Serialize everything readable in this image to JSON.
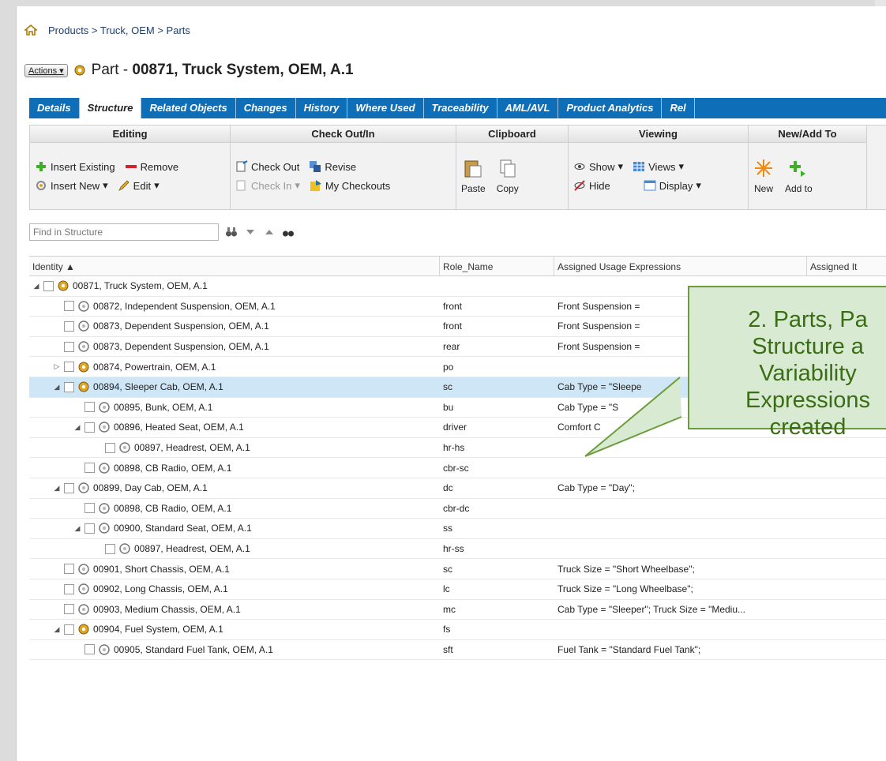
{
  "breadcrumb": "Products > Truck, OEM > Parts",
  "header": {
    "actions_label": "Actions",
    "title_prefix": "Part - ",
    "title_bold": "00871, Truck System, OEM, A.1"
  },
  "tabs": [
    "Details",
    "Structure",
    "Related Objects",
    "Changes",
    "History",
    "Where Used",
    "Traceability",
    "AML/AVL",
    "Product Analytics",
    "Rel"
  ],
  "ribbon": {
    "editing": {
      "title": "Editing",
      "insert_existing": "Insert Existing",
      "remove": "Remove",
      "insert_new": "Insert New",
      "edit": "Edit"
    },
    "checkout": {
      "title": "Check Out/In",
      "check_out": "Check Out",
      "revise": "Revise",
      "check_in": "Check In",
      "my_checkouts": "My Checkouts"
    },
    "clipboard": {
      "title": "Clipboard",
      "paste": "Paste",
      "copy": "Copy"
    },
    "viewing": {
      "title": "Viewing",
      "show": "Show",
      "views": "Views",
      "hide": "Hide",
      "display": "Display"
    },
    "newadd": {
      "title": "New/Add To",
      "new": "New",
      "add_to": "Add to"
    }
  },
  "find": {
    "placeholder": "Find in Structure"
  },
  "columns": [
    "Identity ▲",
    "Role_Name",
    "Assigned Usage Expressions",
    "Assigned It"
  ],
  "rows": [
    {
      "identity": "00871, Truck System, OEM, A.1",
      "role": "",
      "expr": ""
    },
    {
      "identity": "00872, Independent Suspension, OEM, A.1",
      "role": "front",
      "expr": "Front Suspension ="
    },
    {
      "identity": "00873, Dependent Suspension, OEM, A.1",
      "role": "front",
      "expr": "Front Suspension ="
    },
    {
      "identity": "00873, Dependent Suspension, OEM, A.1",
      "role": "rear",
      "expr": "Front Suspension ="
    },
    {
      "identity": "00874, Powertrain, OEM, A.1",
      "role": "po",
      "expr": ""
    },
    {
      "identity": "00894, Sleeper Cab, OEM, A.1",
      "role": "sc",
      "expr": "Cab Type = \"Sleepe"
    },
    {
      "identity": "00895, Bunk, OEM, A.1",
      "role": "bu",
      "expr": "Cab Type = \"S"
    },
    {
      "identity": "00896, Heated Seat, OEM, A.1",
      "role": "driver",
      "expr": "Comfort C"
    },
    {
      "identity": "00897, Headrest, OEM, A.1",
      "role": "hr-hs",
      "expr": ""
    },
    {
      "identity": "00898, CB Radio, OEM, A.1",
      "role": "cbr-sc",
      "expr": ""
    },
    {
      "identity": "00899, Day Cab, OEM, A.1",
      "role": "dc",
      "expr": "Cab Type = \"Day\";"
    },
    {
      "identity": "00898, CB Radio, OEM, A.1",
      "role": "cbr-dc",
      "expr": ""
    },
    {
      "identity": "00900, Standard Seat, OEM, A.1",
      "role": "ss",
      "expr": ""
    },
    {
      "identity": "00897, Headrest, OEM, A.1",
      "role": "hr-ss",
      "expr": ""
    },
    {
      "identity": "00901, Short Chassis, OEM, A.1",
      "role": "sc",
      "expr": "Truck Size = \"Short Wheelbase\";"
    },
    {
      "identity": "00902, Long Chassis, OEM, A.1",
      "role": "lc",
      "expr": "Truck Size = \"Long Wheelbase\";"
    },
    {
      "identity": "00903, Medium Chassis, OEM, A.1",
      "role": "mc",
      "expr": "Cab Type = \"Sleeper\"; Truck Size = \"Mediu..."
    },
    {
      "identity": "00904, Fuel System, OEM, A.1",
      "role": "fs",
      "expr": ""
    },
    {
      "identity": "00905, Standard Fuel Tank, OEM, A.1",
      "role": "sft",
      "expr": "Fuel Tank = \"Standard Fuel Tank\";"
    }
  ],
  "callout": {
    "line1": "2. Parts, Pa",
    "line2": "Structure a",
    "line3": "Variability",
    "line4": "Expressions",
    "line5": "created"
  }
}
